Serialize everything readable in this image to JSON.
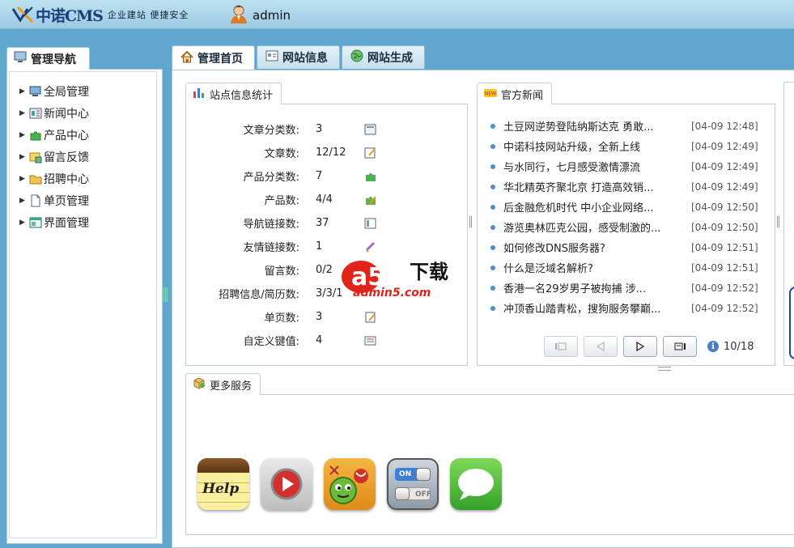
{
  "header": {
    "logo_text": "中诺CMS",
    "slogan": "企业建站 便捷安全",
    "username": "admin"
  },
  "left_nav": {
    "tab_label": "管理导航",
    "items": [
      {
        "label": "全局管理",
        "icon": "computer-icon"
      },
      {
        "label": "新闻中心",
        "icon": "news-icon"
      },
      {
        "label": "产品中心",
        "icon": "puzzle-icon"
      },
      {
        "label": "留言反馈",
        "icon": "message-icon"
      },
      {
        "label": "招聘中心",
        "icon": "folder-icon"
      },
      {
        "label": "单页管理",
        "icon": "page-icon"
      },
      {
        "label": "界面管理",
        "icon": "layout-icon"
      }
    ]
  },
  "main_tabs": [
    {
      "label": "管理首页",
      "icon": "home-icon",
      "active": true
    },
    {
      "label": "网站信息",
      "icon": "info-card-icon",
      "active": false
    },
    {
      "label": "网站生成",
      "icon": "globe-icon",
      "active": false
    }
  ],
  "site_stats": {
    "title": "站点信息统计",
    "rows": [
      {
        "label": "文章分类数:",
        "value": "3"
      },
      {
        "label": "文章数:",
        "value": "12/12"
      },
      {
        "label": "产品分类数:",
        "value": "7"
      },
      {
        "label": "产品数:",
        "value": "4/4"
      },
      {
        "label": "导航链接数:",
        "value": "37"
      },
      {
        "label": "友情链接数:",
        "value": "1"
      },
      {
        "label": "留言数:",
        "value": "0/2"
      },
      {
        "label": "招聘信息/简历数:",
        "value": "3/3/1"
      },
      {
        "label": "单页数:",
        "value": "3"
      },
      {
        "label": "自定义键值:",
        "value": "4"
      }
    ]
  },
  "news": {
    "title": "官方新闻",
    "items": [
      {
        "title": "土豆网逆势登陆纳斯达克 勇敢...",
        "time": "[04-09 12:48]"
      },
      {
        "title": "中诺科技网站升级，全新上线",
        "time": "[04-09 12:49]"
      },
      {
        "title": "与水同行，七月感受激情漂流",
        "time": "[04-09 12:49]"
      },
      {
        "title": "华北精英齐聚北京 打造高效销...",
        "time": "[04-09 12:49]"
      },
      {
        "title": "后金融危机时代 中小企业网络...",
        "time": "[04-09 12:50]"
      },
      {
        "title": "游览奥林匹克公园，感受制激的...",
        "time": "[04-09 12:50]"
      },
      {
        "title": "如何修改DNS服务器?",
        "time": "[04-09 12:51]"
      },
      {
        "title": "什么是泛域名解析?",
        "time": "[04-09 12:51]"
      },
      {
        "title": "香港一名29岁男子被拘捕 涉...",
        "time": "[04-09 12:52]"
      },
      {
        "title": "冲顶香山踏青松，搜狗服务攀巅...",
        "time": "[04-09 12:52]"
      }
    ],
    "pager": {
      "current": 10,
      "total": 18,
      "text": "10/18"
    }
  },
  "services": {
    "title": "更多服务",
    "apps": [
      "notes-help-icon",
      "video-player-icon",
      "game-icon",
      "toggle-switch-icon",
      "chat-bubble-icon"
    ],
    "notes_label": "Help",
    "toggle_on": "ON",
    "toggle_off": "OFF"
  },
  "watermark": {
    "mark": "a5",
    "text": "下载",
    "domain": "admin5.com"
  },
  "colors": {
    "page_bg": "#5fa7cf",
    "accent_blue": "#4a8ed0",
    "logo_blue": "#1b3f7a"
  }
}
